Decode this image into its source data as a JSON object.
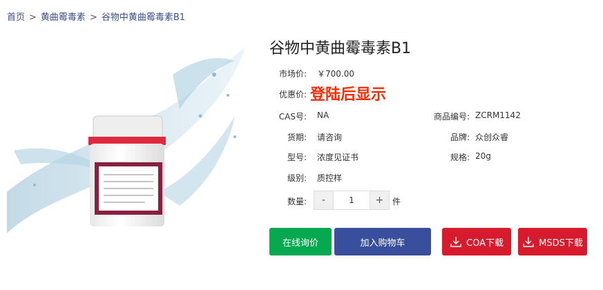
{
  "breadcrumb": {
    "home": "首页",
    "sep1": ">",
    "category": "黄曲霉毒素",
    "sep2": ">",
    "current": "谷物中黄曲霉毒素B1"
  },
  "product": {
    "title": "谷物中黄曲霉毒素B1",
    "market_price_label": "市场价:",
    "market_price_value": "￥700.00",
    "promo_price_label": "优惠价:",
    "promo_price_value": "登陆后显示",
    "cas_label": "CAS号:",
    "cas_value": "NA",
    "product_no_label": "商品编号:",
    "product_no_value": "ZCRM1142",
    "period_label": "货期:",
    "period_value": "请咨询",
    "brand_label": "品牌:",
    "brand_value": "众创众睿",
    "model_label": "型号:",
    "model_value": "浓度见证书",
    "spec_label": "规格:",
    "spec_value": "20g",
    "grade_label": "级别:",
    "grade_value": "质控样",
    "quantity_label": "数量:",
    "quantity_value": "1",
    "quantity_unit": "件",
    "minus_label": "-",
    "plus_label": "+"
  },
  "actions": {
    "inquiry": "在线询价",
    "add_cart": "加入购物车",
    "coa": "COA下载",
    "msds": "MSDS下载"
  },
  "colors": {
    "link": "#3b4f8a",
    "promo": "#ff2a00",
    "inquiry_bg": "#07a950",
    "cart_bg": "#3a4f9c",
    "download_bg": "#d61b2c"
  }
}
